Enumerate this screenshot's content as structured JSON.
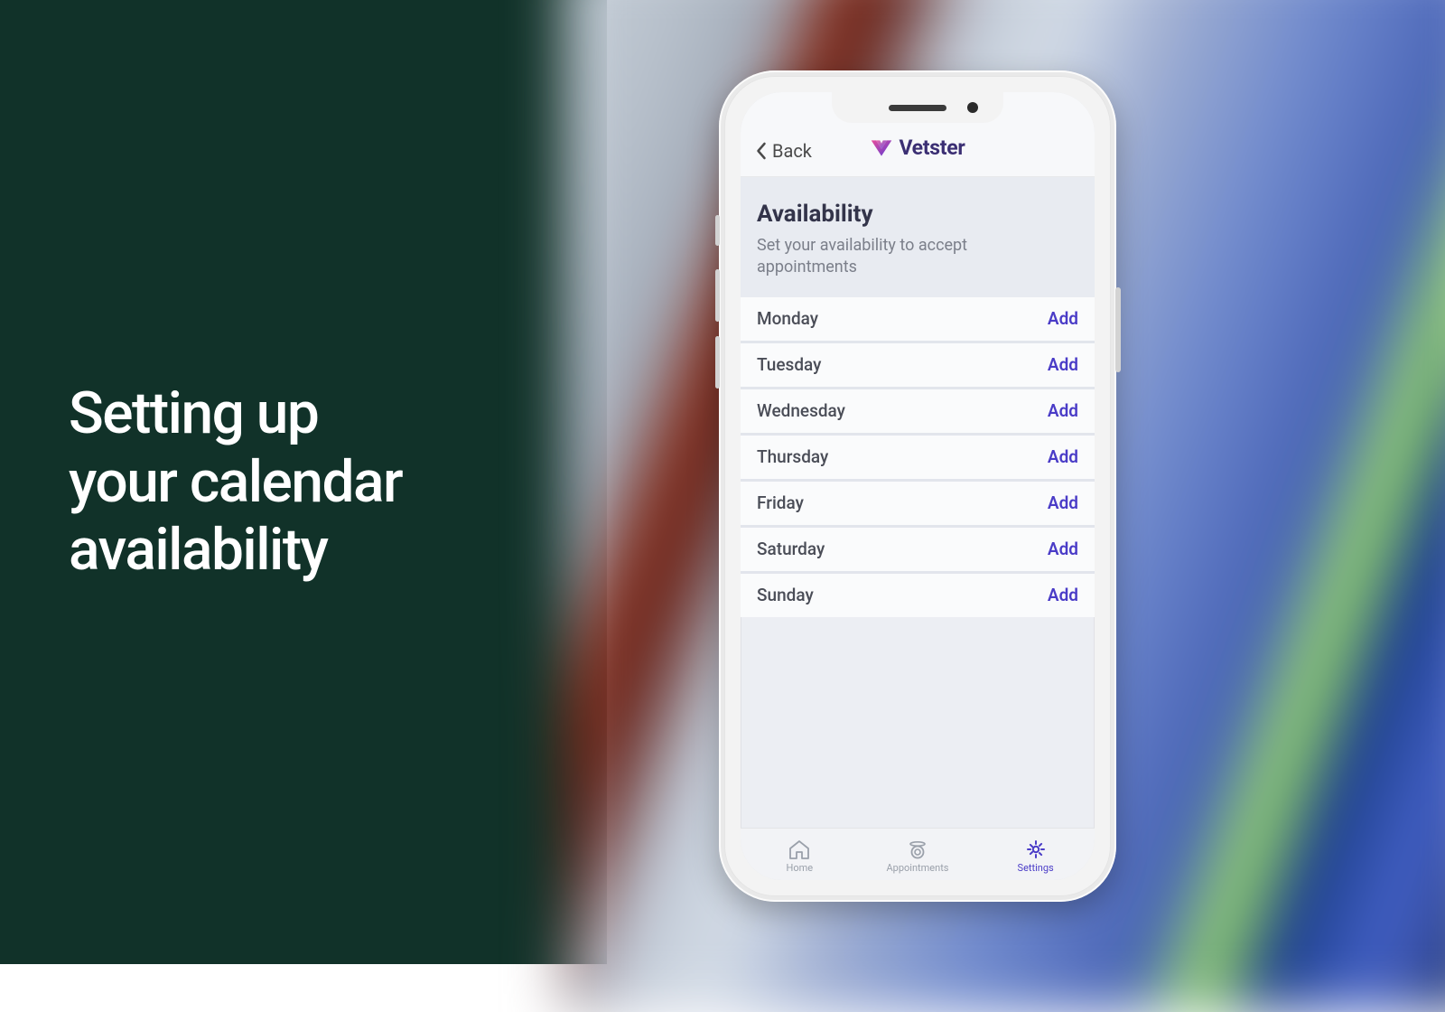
{
  "promo": {
    "title_line1": "Setting up",
    "title_line2": "your calendar",
    "title_line3": "availability"
  },
  "app": {
    "back_label": "Back",
    "brand_name": "Vetster",
    "section": {
      "title": "Availability",
      "subtitle": "Set your availability to accept appointments"
    },
    "days": [
      {
        "name": "Monday",
        "action": "Add"
      },
      {
        "name": "Tuesday",
        "action": "Add"
      },
      {
        "name": "Wednesday",
        "action": "Add"
      },
      {
        "name": "Thursday",
        "action": "Add"
      },
      {
        "name": "Friday",
        "action": "Add"
      },
      {
        "name": "Saturday",
        "action": "Add"
      },
      {
        "name": "Sunday",
        "action": "Add"
      }
    ],
    "tabs": [
      {
        "label": "Home"
      },
      {
        "label": "Appointments"
      },
      {
        "label": "Settings"
      }
    ]
  }
}
